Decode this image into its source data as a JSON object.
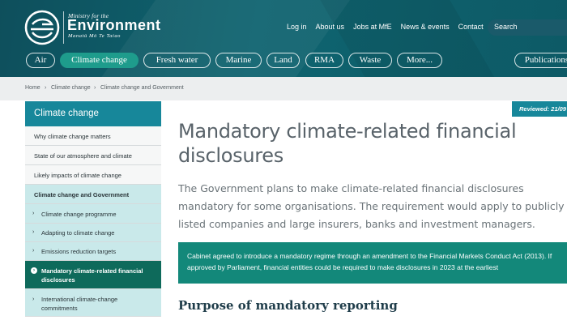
{
  "header": {
    "logo_top": "Ministry for the",
    "logo_main": "Environment",
    "logo_sub": "Manatū Mō Te Taiao",
    "top_links": [
      "Log in",
      "About us",
      "Jobs at MfE",
      "News & events",
      "Contact"
    ],
    "search_placeholder": "Search",
    "tabs": [
      "Air",
      "Climate change",
      "Fresh water",
      "Marine",
      "Land",
      "RMA",
      "Waste",
      "More...",
      "Publications"
    ],
    "active_tab": "Climate change"
  },
  "breadcrumb": [
    "Home",
    "Climate change",
    "Climate change and Government"
  ],
  "sidebar": {
    "heading": "Climate change",
    "items": [
      {
        "label": "Why climate change matters",
        "type": "plain"
      },
      {
        "label": "State of our atmosphere and climate",
        "type": "plain"
      },
      {
        "label": "Likely impacts of climate change",
        "type": "plain"
      },
      {
        "label": "Climate change and Government",
        "type": "section"
      },
      {
        "label": "Climate change programme",
        "type": "sub"
      },
      {
        "label": "Adapting to climate change",
        "type": "sub"
      },
      {
        "label": "Emissions reduction targets",
        "type": "sub"
      },
      {
        "label": "Mandatory climate-related financial disclosures",
        "type": "selected"
      },
      {
        "label": "International climate-change commitments",
        "type": "sub"
      }
    ]
  },
  "main": {
    "reviewed": "Reviewed: 21/09",
    "title": "Mandatory climate-related financial disclosures",
    "intro": "The Government plans to make climate-related financial disclosures mandatory for some organisations. The requirement would apply to publicly listed companies and large insurers, banks and investment managers.",
    "callout": "Cabinet agreed to introduce a mandatory regime through an amendment to the Financial Markets Conduct Act (2013). If approved by Parliament, financial entities could be required to make disclosures in 2023 at the earliest",
    "subheading": "Purpose of mandatory reporting"
  },
  "colors": {
    "header_bg": "#0f6470",
    "accent_teal": "#17879a",
    "callout_bg": "#13887a",
    "selected_bg": "#0e6a5b",
    "sidebar_light": "#c9e9ea"
  }
}
